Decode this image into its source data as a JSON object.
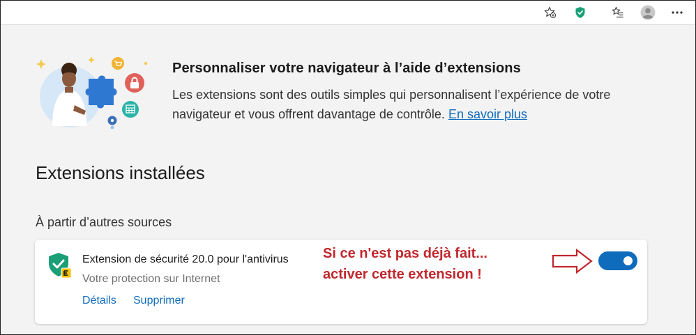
{
  "toolbar": {
    "icons": [
      "favorites-add-icon",
      "shield-extension-icon",
      "collections-icon",
      "profile-avatar-icon",
      "more-menu-icon"
    ]
  },
  "hero": {
    "title": "Personnaliser votre navigateur à l’aide d’extensions",
    "description_line1": "Les extensions sont des outils simples qui personnalisent l’expérience de votre",
    "description_line2": "navigateur et vous offrent davantage de contrôle.",
    "learn_more": "En savoir plus"
  },
  "section": {
    "title": "Extensions installées",
    "subtitle": "À partir d’autres sources"
  },
  "extension": {
    "name": "Extension de sécurité 20.0 pour l'antivirus",
    "description": "Votre protection sur Internet",
    "details_link": "Détails",
    "remove_link": "Supprimer",
    "enabled": true
  },
  "annotation": {
    "line1": "Si ce n'est pas déjà fait...",
    "line2": "activer cette extension !"
  },
  "colors": {
    "accent": "#0f6cbd",
    "annotation": "#c1272d",
    "shield": "#1a9f77"
  }
}
